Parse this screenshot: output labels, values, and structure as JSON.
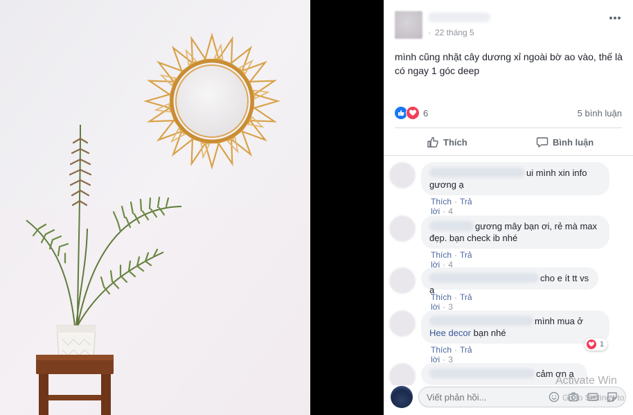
{
  "post": {
    "date": "22 tháng 5",
    "text": "mình cũng nhặt cây dương xỉ ngoài bờ ao vào, thế là có ngay 1 góc deep",
    "reaction_count": "6",
    "reaction_icons": [
      "like-icon",
      "heart-icon"
    ],
    "comment_count": "5 bình luận"
  },
  "actions": {
    "like_label": "Thích",
    "comment_label": "Bình luận"
  },
  "comments": [
    {
      "text": "ui mình xin info gương ạ",
      "time": "4 ngày"
    },
    {
      "text": "gương mây bạn ơi, rẻ mà max đẹp. bạn check ib nhé",
      "time": "4 ngày"
    },
    {
      "text": "cho e ít tt vs ạ",
      "time": "3 ngày"
    },
    {
      "text_before": "mình mua ở",
      "link": "Hee decor",
      "text_after": "bạn nhé",
      "time": "3 ngày",
      "reaction_count": "1"
    },
    {
      "text": "cảm ơn ạ"
    }
  ],
  "comment_actions": {
    "like": "Thích",
    "reply": "Trả lời"
  },
  "reply_box": {
    "placeholder": "Viết phản hồi..."
  },
  "watermark": {
    "line1": "Activate Win",
    "line2": "Go to Settings to"
  },
  "colors": {
    "link": "#385898",
    "like_blue": "#1877f2",
    "heart_red": "#f33e58"
  }
}
